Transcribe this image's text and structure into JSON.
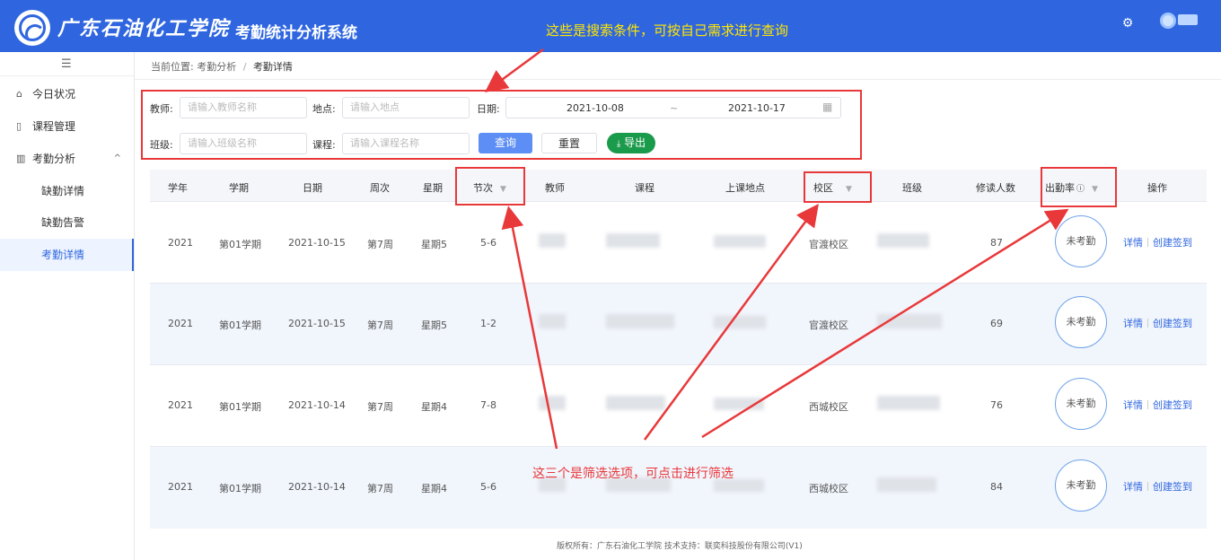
{
  "header": {
    "school_name": "广东石油化工学院",
    "system_title": "考勤统计分析系统",
    "annotation": "这些是搜索条件，可按自己需求进行查询"
  },
  "sidebar": {
    "collapse_icon": "menu-fold-icon",
    "items": [
      {
        "label": "今日状况",
        "icon": "home-icon"
      },
      {
        "label": "课程管理",
        "icon": "book-icon"
      },
      {
        "label": "考勤分析",
        "icon": "chart-icon",
        "expanded": true
      }
    ],
    "subitems": [
      {
        "label": "缺勤详情",
        "active": false
      },
      {
        "label": "缺勤告警",
        "active": false
      },
      {
        "label": "考勤详情",
        "active": true
      }
    ]
  },
  "breadcrumb": {
    "prefix": "当前位置:",
    "parent": "考勤分析",
    "separator": "/",
    "current": "考勤详情"
  },
  "filters": {
    "teacher_label": "教师:",
    "teacher_placeholder": "请输入教师名称",
    "location_label": "地点:",
    "location_placeholder": "请输入地点",
    "date_label": "日期:",
    "date_start": "2021-10-08",
    "date_sep": "~",
    "date_end": "2021-10-17",
    "class_label": "班级:",
    "class_placeholder": "请输入班级名称",
    "course_label": "课程:",
    "course_placeholder": "请输入课程名称",
    "query_button": "查询",
    "reset_button": "重置",
    "export_button": "导出"
  },
  "table": {
    "columns": [
      "学年",
      "学期",
      "日期",
      "周次",
      "星期",
      "节次",
      "教师",
      "课程",
      "上课地点",
      "校区",
      "班级",
      "修读人数",
      "出勤率",
      "操作"
    ],
    "rows": [
      {
        "year": "2021",
        "term": "第01学期",
        "date": "2021-10-15",
        "week": "第7周",
        "weekday": "星期5",
        "section": "5-6",
        "campus": "官渡校区",
        "count": "87",
        "attendance": "未考勤"
      },
      {
        "year": "2021",
        "term": "第01学期",
        "date": "2021-10-15",
        "week": "第7周",
        "weekday": "星期5",
        "section": "1-2",
        "campus": "官渡校区",
        "count": "69",
        "attendance": "未考勤"
      },
      {
        "year": "2021",
        "term": "第01学期",
        "date": "2021-10-14",
        "week": "第7周",
        "weekday": "星期4",
        "section": "7-8",
        "campus": "西城校区",
        "count": "76",
        "attendance": "未考勤"
      },
      {
        "year": "2021",
        "term": "第01学期",
        "date": "2021-10-14",
        "week": "第7周",
        "weekday": "星期4",
        "section": "5-6",
        "campus": "西城校区",
        "count": "84",
        "attendance": "未考勤"
      }
    ],
    "action_detail": "详情",
    "action_checkin": "创建签到"
  },
  "annotation_filters": "这三个是筛选选项，可点击进行筛选",
  "footer": "版权所有：广东石油化工学院 技术支持：联奕科技股份有限公司(V1)",
  "colors": {
    "header_bg": "#2f66e0",
    "annotation_yellow": "#ffe600",
    "annotation_red": "#e8383a",
    "export_green": "#1a9a4b"
  }
}
